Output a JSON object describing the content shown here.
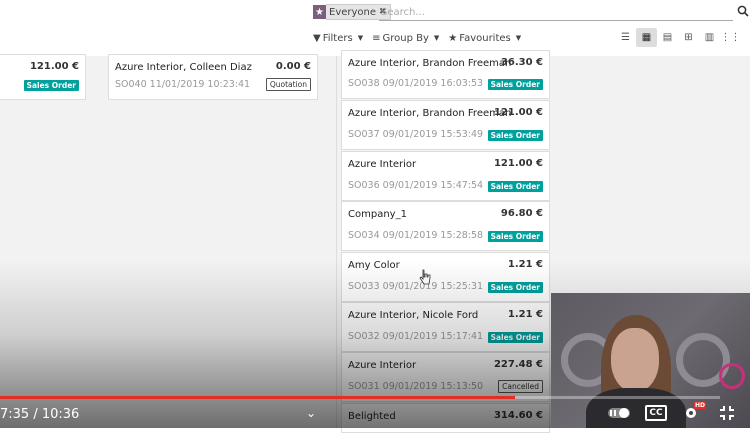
{
  "search": {
    "facet_label": "Everyone",
    "placeholder": "Search..."
  },
  "filters": {
    "filters_label": "Filters",
    "group_by_label": "Group By",
    "favourites_label": "Favourites"
  },
  "views": [
    "list",
    "kanban",
    "calendar",
    "pivot",
    "graph",
    "grid"
  ],
  "left_cards": [
    {
      "title": "",
      "amount": "121.00 €",
      "ref": "",
      "status": "Sales Order"
    },
    {
      "title": "Azure Interior, Colleen Diaz",
      "amount": "0.00 €",
      "ref": "SO040 11/01/2019 10:23:41",
      "status": "Quotation"
    }
  ],
  "right_cards": [
    {
      "title": "Azure Interior, Brandon Freeman",
      "amount": "36.30 €",
      "ref": "SO038 09/01/2019 16:03:53",
      "status": "Sales Order"
    },
    {
      "title": "Azure Interior, Brandon Freeman",
      "amount": "121.00 €",
      "ref": "SO037 09/01/2019 15:53:49",
      "status": "Sales Order"
    },
    {
      "title": "Azure Interior",
      "amount": "121.00 €",
      "ref": "SO036 09/01/2019 15:47:54",
      "status": "Sales Order"
    },
    {
      "title": "Company_1",
      "amount": "96.80 €",
      "ref": "SO034 09/01/2019 15:28:58",
      "status": "Sales Order"
    },
    {
      "title": "Amy Color",
      "amount": "1.21 €",
      "ref": "SO033 09/01/2019 15:25:31",
      "status": "Sales Order"
    },
    {
      "title": "Azure Interior, Nicole Ford",
      "amount": "1.21 €",
      "ref": "SO032 09/01/2019 15:17:41",
      "status": "Sales Order"
    },
    {
      "title": "Azure Interior",
      "amount": "227.48 €",
      "ref": "SO031 09/01/2019 15:13:50",
      "status": "Cancelled"
    },
    {
      "title": "Belighted",
      "amount": "314.60 €",
      "ref": "",
      "status": ""
    }
  ],
  "video": {
    "time": "7:35 / 10:36",
    "progress": 0.715,
    "cc_label": "CC",
    "hd_label": "HD"
  },
  "colors": {
    "sales_badge": "#00a09d",
    "progress": "#e52d27",
    "facet": "#7c5f7c"
  }
}
